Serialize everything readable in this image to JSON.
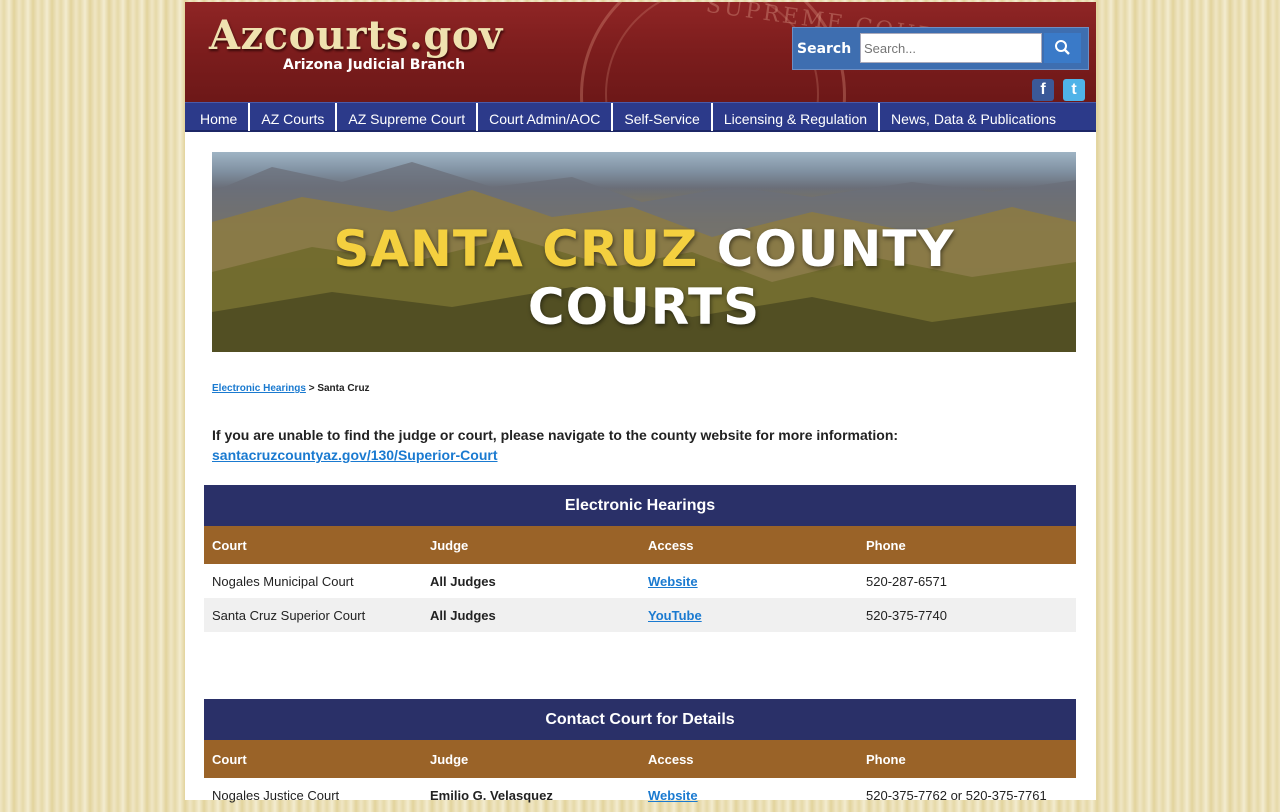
{
  "header": {
    "logo": "Azcourts.gov",
    "sublogo": "Arizona Judicial Branch",
    "seal_text": "SUPREME COURT",
    "search_label": "Search",
    "search_placeholder": "Search..."
  },
  "social": {
    "facebook": "f",
    "twitter": "t"
  },
  "nav": [
    "Home",
    "AZ Courts",
    "AZ Supreme Court",
    "Court Admin/AOC",
    "Self-Service",
    "Licensing & Regulation",
    "News, Data & Publications"
  ],
  "banner": {
    "title_part1": "SANTA CRUZ",
    "title_part2": "COUNTY COURTS"
  },
  "breadcrumb": {
    "link": "Electronic Hearings",
    "separator": ">",
    "current": "Santa Cruz"
  },
  "info": {
    "text": "If you are unable to find the judge or court, please navigate to the county website for more information:",
    "link": "santacruzcountyaz.gov/130/Superior-Court"
  },
  "tables": [
    {
      "title": "Electronic Hearings",
      "headers": [
        "Court",
        "Judge",
        "Access",
        "Phone"
      ],
      "rows": [
        [
          "Nogales Municipal Court",
          "All Judges",
          "Website",
          "520-287-6571"
        ],
        [
          "Santa Cruz Superior Court",
          "All Judges",
          "YouTube",
          "520-375-7740"
        ]
      ]
    },
    {
      "title": "Contact Court for Details",
      "headers": [
        "Court",
        "Judge",
        "Access",
        "Phone"
      ],
      "rows": [
        [
          "Nogales Justice Court",
          "Emilio G. Velasquez",
          "Website",
          "520-375-7762 or 520-375-7761"
        ]
      ]
    }
  ],
  "colors": {
    "header_red": "#7a1c1c",
    "nav_blue": "#2c3a8a",
    "table_title_navy": "#2a3068",
    "table_head_brown": "#9a6328",
    "link_blue": "#1a7ad0",
    "banner_yellow": "#f4d03f"
  }
}
